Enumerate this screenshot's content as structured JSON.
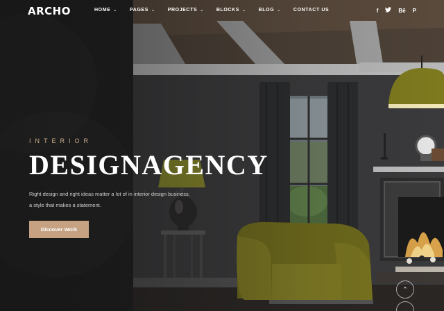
{
  "brand": {
    "logo": "ARCHO"
  },
  "nav": {
    "items": [
      {
        "label": "HOME",
        "has_dropdown": true
      },
      {
        "label": "PAGES",
        "has_dropdown": true
      },
      {
        "label": "PROJECTS",
        "has_dropdown": true
      },
      {
        "label": "BLOCKS",
        "has_dropdown": true
      },
      {
        "label": "BLOG",
        "has_dropdown": true
      },
      {
        "label": "CONTACT US",
        "has_dropdown": false
      }
    ],
    "dropdown_glyph": "⌄"
  },
  "social": [
    {
      "icon": "facebook-icon",
      "glyph": "f"
    },
    {
      "icon": "twitter-icon",
      "glyph": "🐦"
    },
    {
      "icon": "behance-icon",
      "glyph": "Bē"
    },
    {
      "icon": "pinterest-icon",
      "glyph": "P"
    }
  ],
  "hero": {
    "eyebrow": "INTERIOR",
    "headline": "DESIGNAGENCY",
    "description_line1": "Right design and right ideas matter a lot of in interior design business.",
    "description_line2": "a style that makes a statement.",
    "cta_label": "Discover Work"
  },
  "controls": {
    "scroll_up_glyph": "⌃",
    "scroll_down_glyph": "⌄"
  },
  "colors": {
    "accent": "#c6a283",
    "eyebrow": "#c9a98a",
    "panel": "#1e1e1e"
  }
}
